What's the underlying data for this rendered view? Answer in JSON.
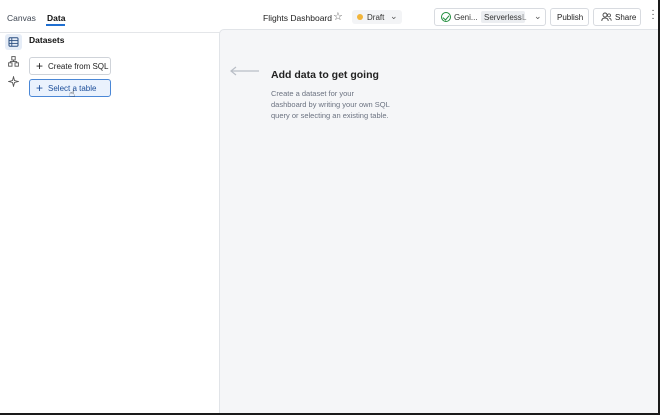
{
  "header": {
    "tabs": [
      {
        "label": "Canvas",
        "active": false
      },
      {
        "label": "Data",
        "active": true
      }
    ],
    "title": "Flights Dashboard",
    "status": {
      "label": "Draft",
      "color": "#f2b53a"
    },
    "compute": {
      "name": "Geni...",
      "type": "Serverless",
      "size": "L"
    },
    "publish_label": "Publish",
    "share_label": "Share"
  },
  "rail": {
    "items": [
      {
        "icon": "datasets-icon",
        "active": true
      },
      {
        "icon": "lineage-icon",
        "active": false
      },
      {
        "icon": "sparkle-icon",
        "active": false
      }
    ]
  },
  "datasets": {
    "heading": "Datasets",
    "buttons": [
      {
        "label": "Create from SQL",
        "selected": false
      },
      {
        "label": "Select a table",
        "selected": true
      }
    ]
  },
  "empty_state": {
    "title": "Add data to get going",
    "description": "Create a dataset for your dashboard by writing your own SQL query or selecting an existing table."
  },
  "colors": {
    "accent": "#1f6fd1",
    "success": "#1f8c3b"
  }
}
